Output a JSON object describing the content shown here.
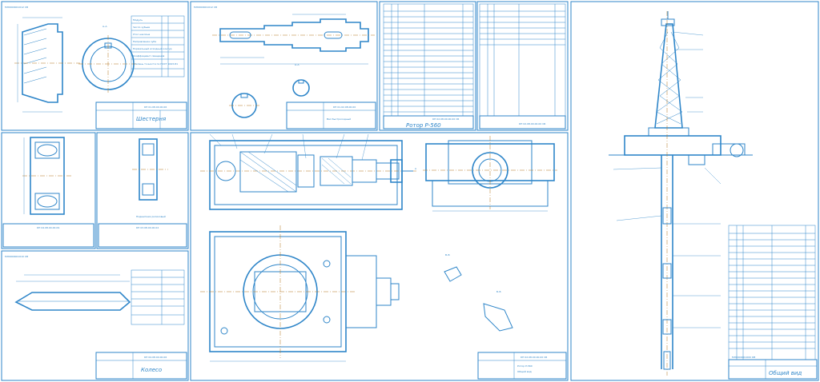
{
  "drawings": {
    "gear_pinion": {
      "code": "МЛ0000001012 СВ",
      "title": "Шестерня",
      "doc": "КП 01.08.00.00.06",
      "section": "А–А"
    },
    "shaft": {
      "code": "МЛ0000001012 СВ",
      "title": "Вал быстроходный",
      "doc": "КП 01.02.08.00.00",
      "section": "А–А"
    },
    "bearing_1": {
      "doc": "КП 04.08.00.00.09"
    },
    "bearing_2": {
      "doc": "КП 03.08.00.00.02",
      "note": "Подшипник роликовый"
    },
    "wheel": {
      "code": "МЛ0000001010 СВ",
      "title": "Колесо",
      "doc": "КП 04.08.00.00.06"
    },
    "rotor_assembly": {
      "title": "Ротор Р-560",
      "subtitle": "Общий вид",
      "doc": "КП 02.08.00.00.00 СБ",
      "section_labels": [
        "А",
        "Б–Б",
        "В–В"
      ]
    },
    "spec_sheet_1": {
      "title": "Ротор Р-560",
      "doc": "КП 02.08.00.00.00 СБ"
    },
    "spec_sheet_2": {
      "doc": "КП 02.08.00.00.00 СБ"
    },
    "general_view": {
      "code": "МЛ0000001000 ОВ",
      "title": "Общий вид"
    }
  },
  "gear_table": [
    "Модуль",
    "Число зубьев",
    "Угол наклона",
    "Направление зуба",
    "Нормальный исходный контур",
    "Коэффициент смещения",
    "Степень точности по ГОСТ 1643-81"
  ],
  "gear_values": [
    "m",
    "z",
    "β",
    "",
    "",
    "x",
    ""
  ],
  "part_numbers": [
    "1",
    "2",
    "3",
    "4",
    "5",
    "6",
    "7",
    "8",
    "9",
    "10",
    "11",
    "12",
    "13",
    "14",
    "15",
    "16",
    "17",
    "18",
    "19",
    "20",
    "21",
    "22",
    "23",
    "24",
    "25",
    "26",
    "27",
    "28"
  ]
}
